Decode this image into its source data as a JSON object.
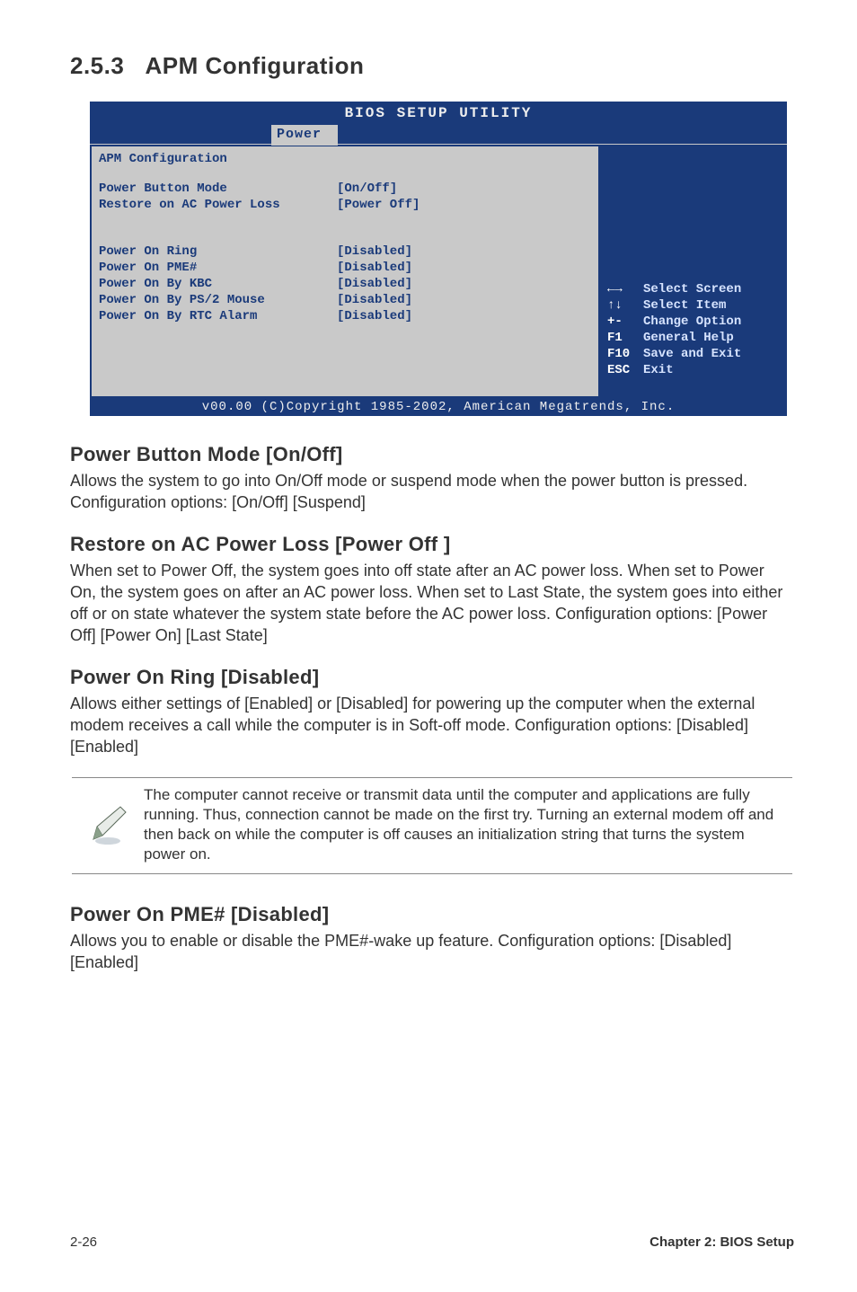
{
  "section_number": "2.5.3",
  "section_title": "APM Configuration",
  "bios": {
    "header_title": "BIOS SETUP UTILITY",
    "active_tab": "Power",
    "panel_heading": "APM Configuration",
    "rows1": [
      {
        "label": "Power Button Mode",
        "value": "[On/Off]"
      },
      {
        "label": "Restore on AC Power Loss",
        "value": "[Power Off]"
      }
    ],
    "rows2": [
      {
        "label": "Power On Ring",
        "value": "[Disabled]"
      },
      {
        "label": "Power On PME#",
        "value": "[Disabled]"
      },
      {
        "label": "Power On By KBC",
        "value": "[Disabled]"
      },
      {
        "label": "Power On By PS/2 Mouse",
        "value": "[Disabled]"
      },
      {
        "label": "Power On By RTC Alarm",
        "value": "[Disabled]"
      }
    ],
    "help": [
      {
        "key": "←→",
        "desc": "Select Screen"
      },
      {
        "key": "↑↓",
        "desc": "Select Item"
      },
      {
        "key": "+-",
        "desc": "Change Option"
      },
      {
        "key": "F1",
        "desc": "General Help"
      },
      {
        "key": "F10",
        "desc": "Save and Exit"
      },
      {
        "key": "ESC",
        "desc": "Exit"
      }
    ],
    "footer": "v00.00 (C)Copyright 1985-2002, American Megatrends, Inc."
  },
  "settings": [
    {
      "title": "Power Button Mode [On/Off]",
      "body": "Allows the system to go into On/Off mode or suspend mode when the power button is pressed. Configuration options: [On/Off] [Suspend]"
    },
    {
      "title": "Restore on AC Power Loss [Power Off ]",
      "body": "When set to Power Off, the system goes into off state after an AC power loss. When set to Power On, the system goes on after an AC power loss. When set to Last State, the system goes into either off or on state whatever the system state before the AC power loss. Configuration options: [Power Off] [Power On] [Last State]"
    },
    {
      "title": "Power On Ring [Disabled]",
      "body": "Allows either settings of [Enabled] or [Disabled] for powering up the computer when the external modem receives a call while the computer is in Soft-off mode. Configuration options: [Disabled] [Enabled]"
    }
  ],
  "note": "The computer cannot receive or transmit data until the computer and applications are fully running. Thus, connection cannot be made on the first try. Turning an external modem off and then back on while the computer is off causes an initialization string that turns the system power on.",
  "settings2": [
    {
      "title": "Power On PME# [Disabled]",
      "body": "Allows you to enable or disable the PME#-wake up feature. Configuration options: [Disabled] [Enabled]"
    }
  ],
  "footer": {
    "page": "2-26",
    "chapter": "Chapter 2: BIOS Setup"
  }
}
